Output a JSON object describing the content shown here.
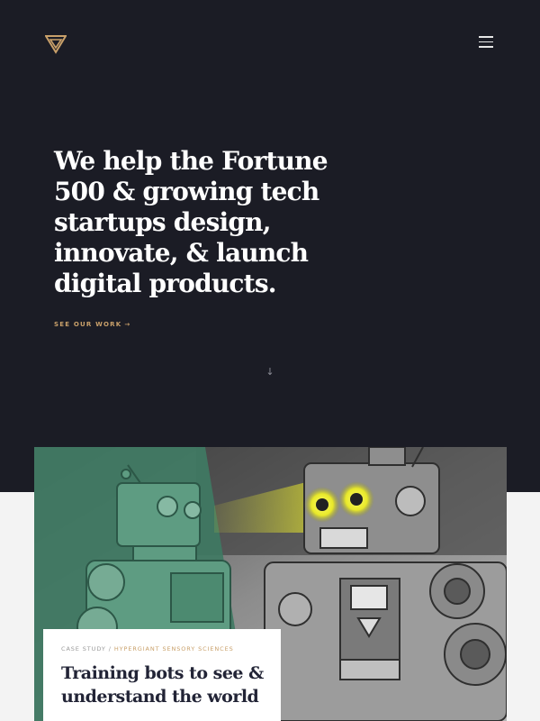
{
  "header": {
    "logo_icon": "triangle-logo-icon",
    "menu_icon": "hamburger-menu-icon"
  },
  "hero": {
    "headline": "We help the Fortune 500 & growing tech startups design, innovate, & launch digital products.",
    "cta_label": "SEE OUR WORK",
    "cta_arrow": "→",
    "scroll_arrow": "↓"
  },
  "case_study": {
    "label": "CASE STUDY",
    "separator": "/",
    "client": "HYPERGIANT SENSORY SCIENCES",
    "title": "Training bots to see & understand the world",
    "image_icon": "robots-illustration"
  },
  "colors": {
    "hero_bg": "#1b1c25",
    "page_bg": "#f3f3f3",
    "accent": "#c9a06a",
    "title_text": "#222436"
  }
}
